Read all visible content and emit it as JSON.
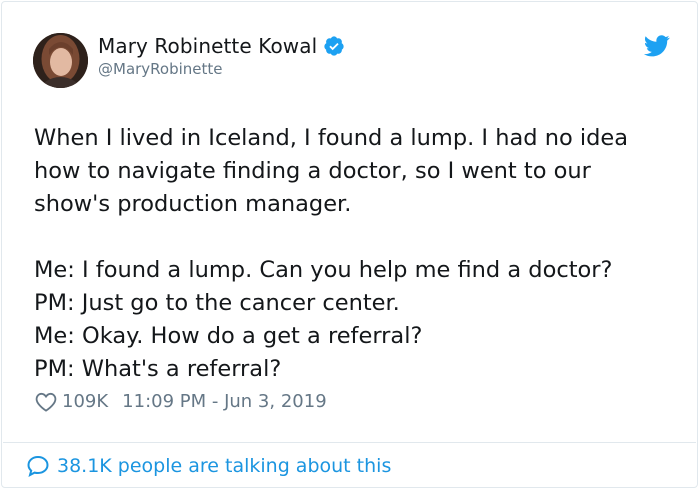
{
  "tweet": {
    "author_name": "Mary Robinette Kowal",
    "author_handle": "@MaryRobinette",
    "body": "When I lived in Iceland, I found a lump. I had no idea how to navigate finding a doctor, so I went to our show's production manager.\n\nMe: I found a lump. Can you help me find a doctor?\nPM: Just go to the cancer center.\nMe: Okay. How do a get a referral?\nPM: What's a referral?",
    "likes": "109K",
    "timestamp": "11:09 PM - Jun 3, 2019",
    "conversation": "38.1K people are talking about this"
  },
  "icons": {
    "verified": "verified-badge-icon",
    "bird": "twitter-bird-icon",
    "heart": "heart-icon",
    "bubble": "comment-bubble-icon"
  },
  "colors": {
    "accent": "#1da1f2",
    "link": "#1b95e0",
    "muted": "#657786",
    "text": "#14171a",
    "border": "#e1e8ed"
  }
}
